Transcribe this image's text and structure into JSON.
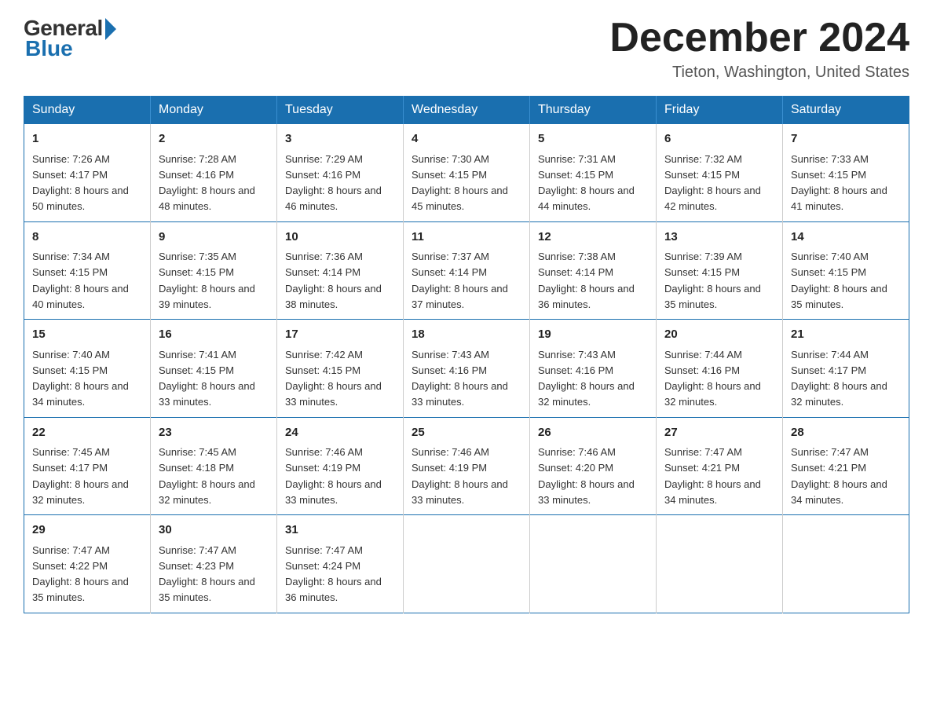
{
  "logo": {
    "general": "General",
    "blue": "Blue"
  },
  "header": {
    "month": "December 2024",
    "location": "Tieton, Washington, United States"
  },
  "weekdays": [
    "Sunday",
    "Monday",
    "Tuesday",
    "Wednesday",
    "Thursday",
    "Friday",
    "Saturday"
  ],
  "weeks": [
    [
      {
        "day": "1",
        "sunrise": "7:26 AM",
        "sunset": "4:17 PM",
        "daylight": "8 hours and 50 minutes."
      },
      {
        "day": "2",
        "sunrise": "7:28 AM",
        "sunset": "4:16 PM",
        "daylight": "8 hours and 48 minutes."
      },
      {
        "day": "3",
        "sunrise": "7:29 AM",
        "sunset": "4:16 PM",
        "daylight": "8 hours and 46 minutes."
      },
      {
        "day": "4",
        "sunrise": "7:30 AM",
        "sunset": "4:15 PM",
        "daylight": "8 hours and 45 minutes."
      },
      {
        "day": "5",
        "sunrise": "7:31 AM",
        "sunset": "4:15 PM",
        "daylight": "8 hours and 44 minutes."
      },
      {
        "day": "6",
        "sunrise": "7:32 AM",
        "sunset": "4:15 PM",
        "daylight": "8 hours and 42 minutes."
      },
      {
        "day": "7",
        "sunrise": "7:33 AM",
        "sunset": "4:15 PM",
        "daylight": "8 hours and 41 minutes."
      }
    ],
    [
      {
        "day": "8",
        "sunrise": "7:34 AM",
        "sunset": "4:15 PM",
        "daylight": "8 hours and 40 minutes."
      },
      {
        "day": "9",
        "sunrise": "7:35 AM",
        "sunset": "4:15 PM",
        "daylight": "8 hours and 39 minutes."
      },
      {
        "day": "10",
        "sunrise": "7:36 AM",
        "sunset": "4:14 PM",
        "daylight": "8 hours and 38 minutes."
      },
      {
        "day": "11",
        "sunrise": "7:37 AM",
        "sunset": "4:14 PM",
        "daylight": "8 hours and 37 minutes."
      },
      {
        "day": "12",
        "sunrise": "7:38 AM",
        "sunset": "4:14 PM",
        "daylight": "8 hours and 36 minutes."
      },
      {
        "day": "13",
        "sunrise": "7:39 AM",
        "sunset": "4:15 PM",
        "daylight": "8 hours and 35 minutes."
      },
      {
        "day": "14",
        "sunrise": "7:40 AM",
        "sunset": "4:15 PM",
        "daylight": "8 hours and 35 minutes."
      }
    ],
    [
      {
        "day": "15",
        "sunrise": "7:40 AM",
        "sunset": "4:15 PM",
        "daylight": "8 hours and 34 minutes."
      },
      {
        "day": "16",
        "sunrise": "7:41 AM",
        "sunset": "4:15 PM",
        "daylight": "8 hours and 33 minutes."
      },
      {
        "day": "17",
        "sunrise": "7:42 AM",
        "sunset": "4:15 PM",
        "daylight": "8 hours and 33 minutes."
      },
      {
        "day": "18",
        "sunrise": "7:43 AM",
        "sunset": "4:16 PM",
        "daylight": "8 hours and 33 minutes."
      },
      {
        "day": "19",
        "sunrise": "7:43 AM",
        "sunset": "4:16 PM",
        "daylight": "8 hours and 32 minutes."
      },
      {
        "day": "20",
        "sunrise": "7:44 AM",
        "sunset": "4:16 PM",
        "daylight": "8 hours and 32 minutes."
      },
      {
        "day": "21",
        "sunrise": "7:44 AM",
        "sunset": "4:17 PM",
        "daylight": "8 hours and 32 minutes."
      }
    ],
    [
      {
        "day": "22",
        "sunrise": "7:45 AM",
        "sunset": "4:17 PM",
        "daylight": "8 hours and 32 minutes."
      },
      {
        "day": "23",
        "sunrise": "7:45 AM",
        "sunset": "4:18 PM",
        "daylight": "8 hours and 32 minutes."
      },
      {
        "day": "24",
        "sunrise": "7:46 AM",
        "sunset": "4:19 PM",
        "daylight": "8 hours and 33 minutes."
      },
      {
        "day": "25",
        "sunrise": "7:46 AM",
        "sunset": "4:19 PM",
        "daylight": "8 hours and 33 minutes."
      },
      {
        "day": "26",
        "sunrise": "7:46 AM",
        "sunset": "4:20 PM",
        "daylight": "8 hours and 33 minutes."
      },
      {
        "day": "27",
        "sunrise": "7:47 AM",
        "sunset": "4:21 PM",
        "daylight": "8 hours and 34 minutes."
      },
      {
        "day": "28",
        "sunrise": "7:47 AM",
        "sunset": "4:21 PM",
        "daylight": "8 hours and 34 minutes."
      }
    ],
    [
      {
        "day": "29",
        "sunrise": "7:47 AM",
        "sunset": "4:22 PM",
        "daylight": "8 hours and 35 minutes."
      },
      {
        "day": "30",
        "sunrise": "7:47 AM",
        "sunset": "4:23 PM",
        "daylight": "8 hours and 35 minutes."
      },
      {
        "day": "31",
        "sunrise": "7:47 AM",
        "sunset": "4:24 PM",
        "daylight": "8 hours and 36 minutes."
      },
      null,
      null,
      null,
      null
    ]
  ],
  "colors": {
    "header_bg": "#1a6faf",
    "border": "#1a6faf"
  }
}
